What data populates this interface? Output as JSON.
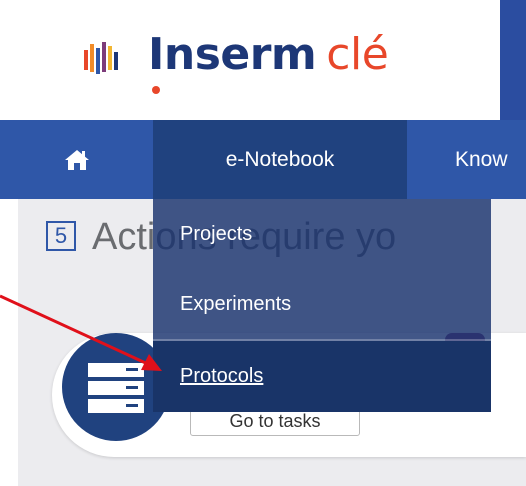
{
  "header": {
    "logo_brand": "Inserm",
    "logo_product": "clé",
    "logo_icon": "inserm-bars-logo"
  },
  "nav": {
    "home_icon": "home-icon",
    "enotebook_label": "e-Notebook",
    "knowledge_label": "Know"
  },
  "dropdown": {
    "items": [
      {
        "label": "Projects"
      },
      {
        "label": "Experiments"
      },
      {
        "label": "Protocols"
      }
    ]
  },
  "content": {
    "actions_count": "5",
    "actions_text": "Actions require yo",
    "goto_tasks_label": "Go to tasks",
    "tasks_icon": "server-stack-icon"
  },
  "colors": {
    "primary": "#2f57a8",
    "primary_dark": "#20427f",
    "accent_red": "#e8472a",
    "annotation_arrow": "#e0101a"
  }
}
